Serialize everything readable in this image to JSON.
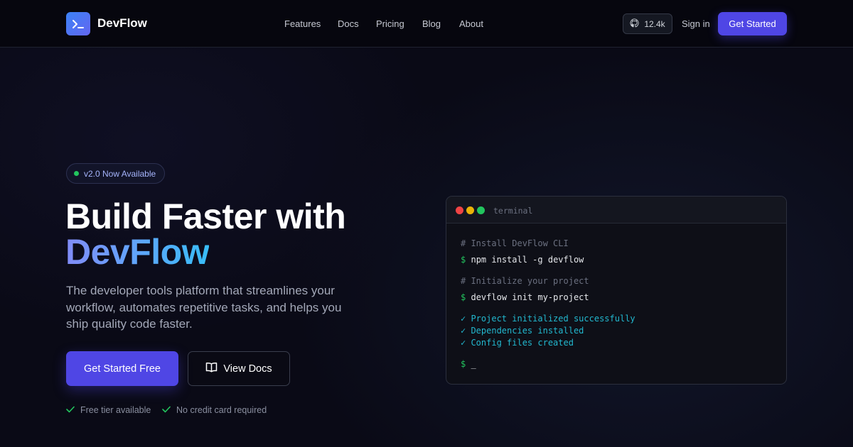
{
  "nav": {
    "brand": "DevFlow",
    "links": [
      "Features",
      "Docs",
      "Pricing",
      "Blog",
      "About"
    ],
    "github_stars": "12.4k",
    "signin": "Sign in",
    "cta": "Get Started"
  },
  "hero": {
    "badge": "v2.0 Now Available",
    "title_line1": "Build Faster with",
    "title_line2": "DevFlow",
    "description": "The developer tools platform that streamlines your workflow, automates repetitive tasks, and helps you ship quality code faster.",
    "primary_button": "Get Started Free",
    "secondary_button": "View Docs",
    "perks": [
      "Free tier available",
      "No credit card required"
    ]
  },
  "terminal": {
    "title": "terminal",
    "lines": {
      "c1": "# Install DevFlow CLI",
      "p1": "$",
      "cmd1": "npm install -g devflow",
      "c2": "# Initialize your project",
      "p2": "$",
      "cmd2": "devflow init my-project",
      "ok1": "✓ Project initialized successfully",
      "ok2": "✓ Dependencies installed",
      "ok3": "✓ Config files created",
      "p3": "$",
      "cursor": "_"
    }
  },
  "colors": {
    "accent": "#4f46e5",
    "success": "#22c55e",
    "terminal_ok": "#22b8cf",
    "background": "#0a0a16"
  },
  "icons": {
    "logo": "terminal-prompt-icon",
    "stars": "github-icon",
    "docs": "book-open-icon",
    "perk": "check-icon"
  }
}
